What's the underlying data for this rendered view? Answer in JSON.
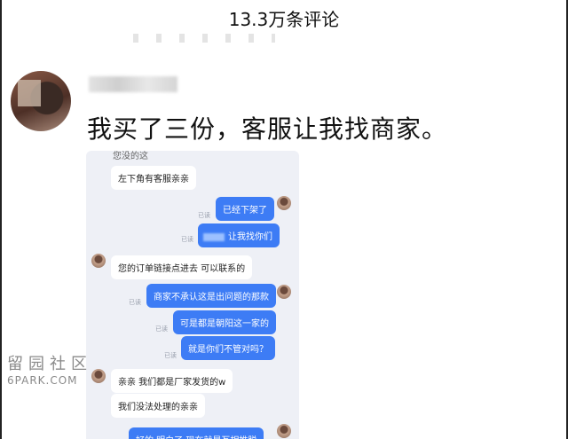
{
  "header": {
    "title": "13.3万条评论"
  },
  "comment": {
    "text": "我买了三份，客服让我找商家。"
  },
  "chat": {
    "cut_top": "您没的这",
    "messages": [
      {
        "side": "left",
        "text": "左下角有客服亲亲"
      },
      {
        "side": "right",
        "text": "已经下架了",
        "status": "已读"
      },
      {
        "side": "right",
        "text": "让我找你们",
        "status": "已读",
        "blurred_prefix": true
      },
      {
        "side": "left",
        "text": "您的订单链接点进去  可以联系的"
      },
      {
        "side": "right",
        "text": "商家不承认这是出问题的那款",
        "status": "已读"
      },
      {
        "side": "right",
        "text": "可是都是朝阳这一家的",
        "status": "已读"
      },
      {
        "side": "right",
        "text": "就是你们不管对吗？",
        "status": "已读"
      },
      {
        "side": "left",
        "text": "亲亲   我们都是厂家发货的w"
      },
      {
        "side": "left",
        "text": "我们没法处理的亲亲"
      },
      {
        "side": "right",
        "text": "好的   明白了   现在就是互相推脱"
      }
    ]
  },
  "watermark": {
    "cn": "留园社区",
    "en": "6PARK.COM"
  }
}
